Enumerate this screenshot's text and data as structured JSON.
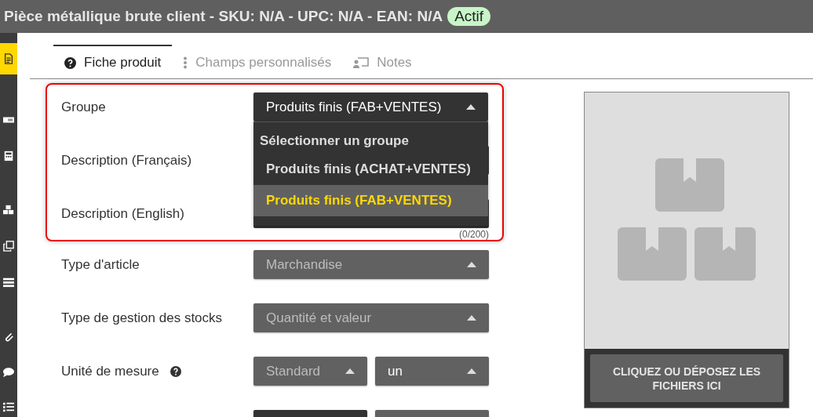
{
  "title": {
    "text": "Pièce métallique brute client - SKU: N/A - UPC: N/A - EAN: N/A",
    "status": "Actif"
  },
  "sidebar": {
    "items": [
      {
        "selected": true
      },
      {
        "selected": false
      },
      {
        "selected": false
      },
      {
        "selected": false
      },
      {
        "selected": false
      },
      {
        "selected": false
      },
      {
        "selected": false
      },
      {
        "selected": false
      },
      {
        "selected": false
      }
    ]
  },
  "tabs": [
    {
      "label": "Fiche produit",
      "selected": true
    },
    {
      "label": "Champs personnalisés",
      "selected": false
    },
    {
      "label": "Notes",
      "selected": false
    }
  ],
  "highlighted_fields": [
    {
      "label": "Groupe",
      "kind": "select",
      "selects": [
        {
          "value": "Produits finis (FAB+VENTES)",
          "disabled": false,
          "active": true,
          "expanded": true,
          "options": [
            {
              "label": "Sélectionner un groupe",
              "kind": "header"
            },
            {
              "label": "Produits finis (ACHAT+VENTES)",
              "kind": "option",
              "selected": false
            },
            {
              "label": "Produits finis (FAB+VENTES)",
              "kind": "option",
              "selected": true
            }
          ]
        }
      ]
    },
    {
      "label": "Description (Français)",
      "kind": "text"
    },
    {
      "label": "Description (English)",
      "kind": "text",
      "counter": "(0/200)"
    }
  ],
  "fields": [
    {
      "label": "Type d'article",
      "kind": "select",
      "selects": [
        {
          "value": "Marchandise",
          "disabled": true,
          "active": false
        }
      ]
    },
    {
      "label": "Type de gestion des stocks",
      "kind": "select",
      "selects": [
        {
          "value": "Quantité et valeur",
          "disabled": true,
          "active": false
        }
      ]
    },
    {
      "label": "Unité de mesure",
      "help": true,
      "kind": "select",
      "selects": [
        {
          "value": "Standard",
          "disabled": true,
          "active": false
        },
        {
          "value": "un",
          "disabled": false,
          "active": false
        }
      ]
    },
    {
      "kind": "select",
      "selects": [
        {
          "active": true
        },
        {
          "active": false
        }
      ]
    }
  ],
  "image_panel": {
    "kind": "picture",
    "upload_button": "CLIQUEZ OU DÉPOSEZ LES FICHIERS ICI"
  }
}
